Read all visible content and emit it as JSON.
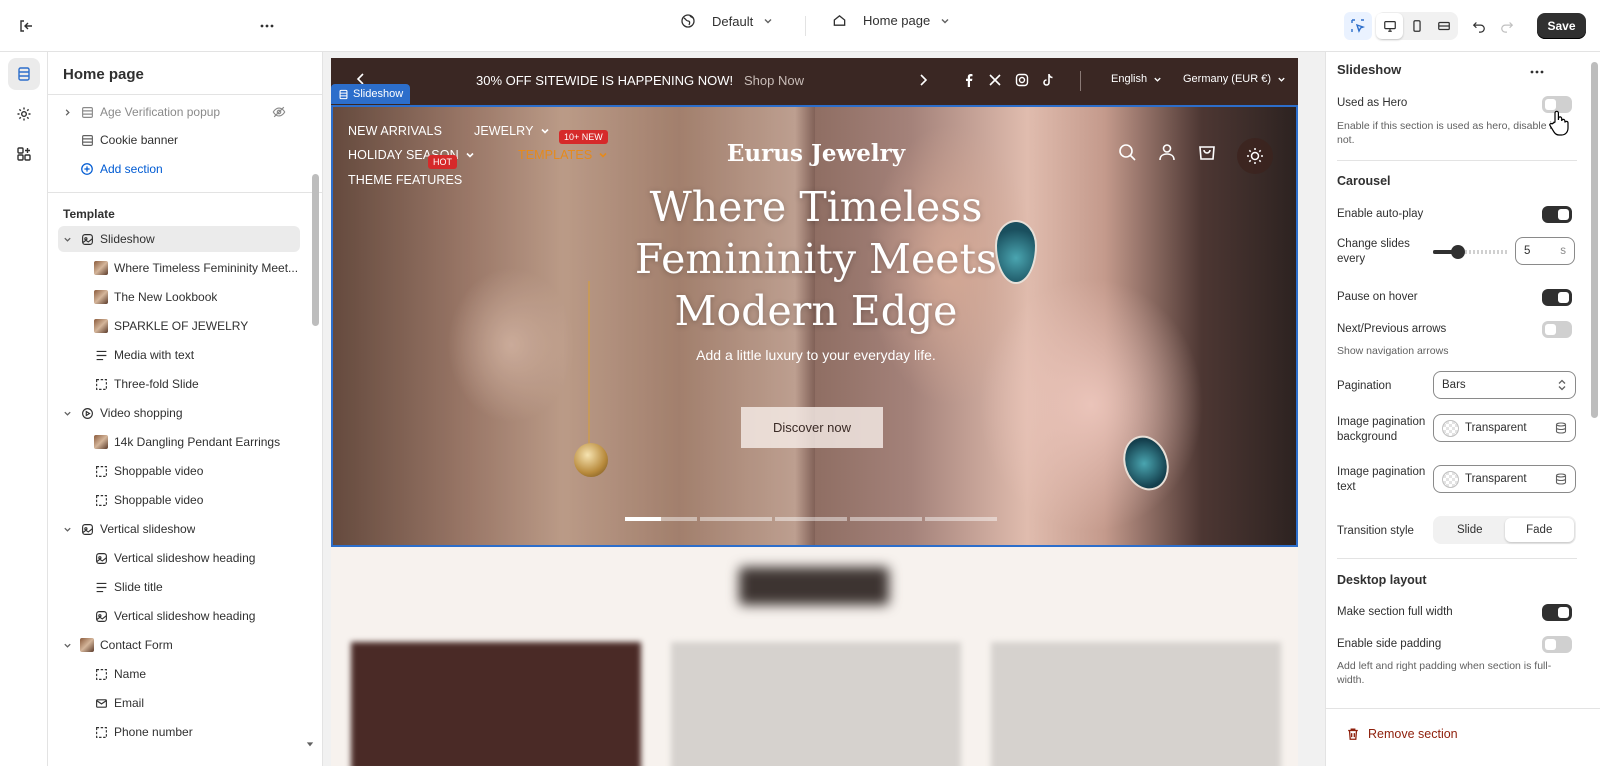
{
  "topbar": {
    "theme_name": "Default",
    "page_name": "Home page",
    "save_label": "Save"
  },
  "sidebar": {
    "title": "Home page",
    "header_items": [
      {
        "label": "Age Verification popup"
      },
      {
        "label": "Cookie banner"
      },
      {
        "label": "Add section"
      }
    ],
    "template_label": "Template",
    "tree": [
      {
        "label": "Slideshow"
      },
      {
        "label": "Where Timeless Femininity Meet..."
      },
      {
        "label": "The New Lookbook"
      },
      {
        "label": "SPARKLE OF JEWELRY"
      },
      {
        "label": "Media with text"
      },
      {
        "label": "Three-fold Slide"
      },
      {
        "label": "Video shopping"
      },
      {
        "label": "14k Dangling Pendant Earrings"
      },
      {
        "label": "Shoppable video"
      },
      {
        "label": "Shoppable video"
      },
      {
        "label": "Vertical slideshow"
      },
      {
        "label": "Vertical slideshow heading"
      },
      {
        "label": "Slide title"
      },
      {
        "label": "Vertical slideshow heading"
      },
      {
        "label": "Contact Form"
      },
      {
        "label": "Name"
      },
      {
        "label": "Email"
      },
      {
        "label": "Phone number"
      }
    ]
  },
  "preview": {
    "announcement": "30% OFF SITEWIDE IS HAPPENING NOW!",
    "shop_now": "Shop Now",
    "language": "English",
    "currency": "Germany (EUR €)",
    "section_tag": "Slideshow",
    "nav": {
      "new_arrivals": "NEW ARRIVALS",
      "jewelry": "JEWELRY",
      "holiday": "HOLIDAY SEASON",
      "templates": "TEMPLATES",
      "theme_features": "THEME FEATURES",
      "badge_new": "10+ NEW",
      "badge_hot": "HOT"
    },
    "brand": "Eurus Jewelry",
    "headline": "Where Timeless Femininity Meets Modern Edge",
    "subheading": "Add a little luxury to your everyday life.",
    "cta": "Discover now",
    "pagination_count": 5,
    "pagination_active": 0,
    "pagination_active_progress": 0.5
  },
  "panel": {
    "title": "Slideshow",
    "used_as_hero": {
      "label": "Used as Hero",
      "help": "Enable if this section is used as hero, disable if not.",
      "on": false
    },
    "carousel_heading": "Carousel",
    "autoplay": {
      "label": "Enable auto-play",
      "on": true
    },
    "change_every": {
      "label": "Change slides every",
      "value": "5",
      "unit": "s",
      "slider_fraction": 0.3
    },
    "pause_hover": {
      "label": "Pause on hover",
      "on": true
    },
    "arrows": {
      "label": "Next/Previous arrows",
      "help": "Show navigation arrows",
      "on": false
    },
    "pagination": {
      "label": "Pagination",
      "value": "Bars"
    },
    "img_pag_bg": {
      "label": "Image pagination background",
      "value": "Transparent"
    },
    "img_pag_text": {
      "label": "Image pagination text",
      "value": "Transparent"
    },
    "transition": {
      "label": "Transition style",
      "options": [
        "Slide",
        "Fade"
      ],
      "selected": "Fade"
    },
    "desktop_heading": "Desktop layout",
    "full_width": {
      "label": "Make section full width",
      "on": true
    },
    "side_padding": {
      "label": "Enable side padding",
      "help": "Add left and right padding when section is full-width.",
      "on": false
    },
    "remove_label": "Remove section"
  },
  "colors": {
    "accent_blue": "#2c6ecb",
    "announcement_bg": "#3a2723",
    "nav_orange": "#e58a1c",
    "badge_red": "#d62a2a",
    "remove_red": "#8e1f0b"
  }
}
